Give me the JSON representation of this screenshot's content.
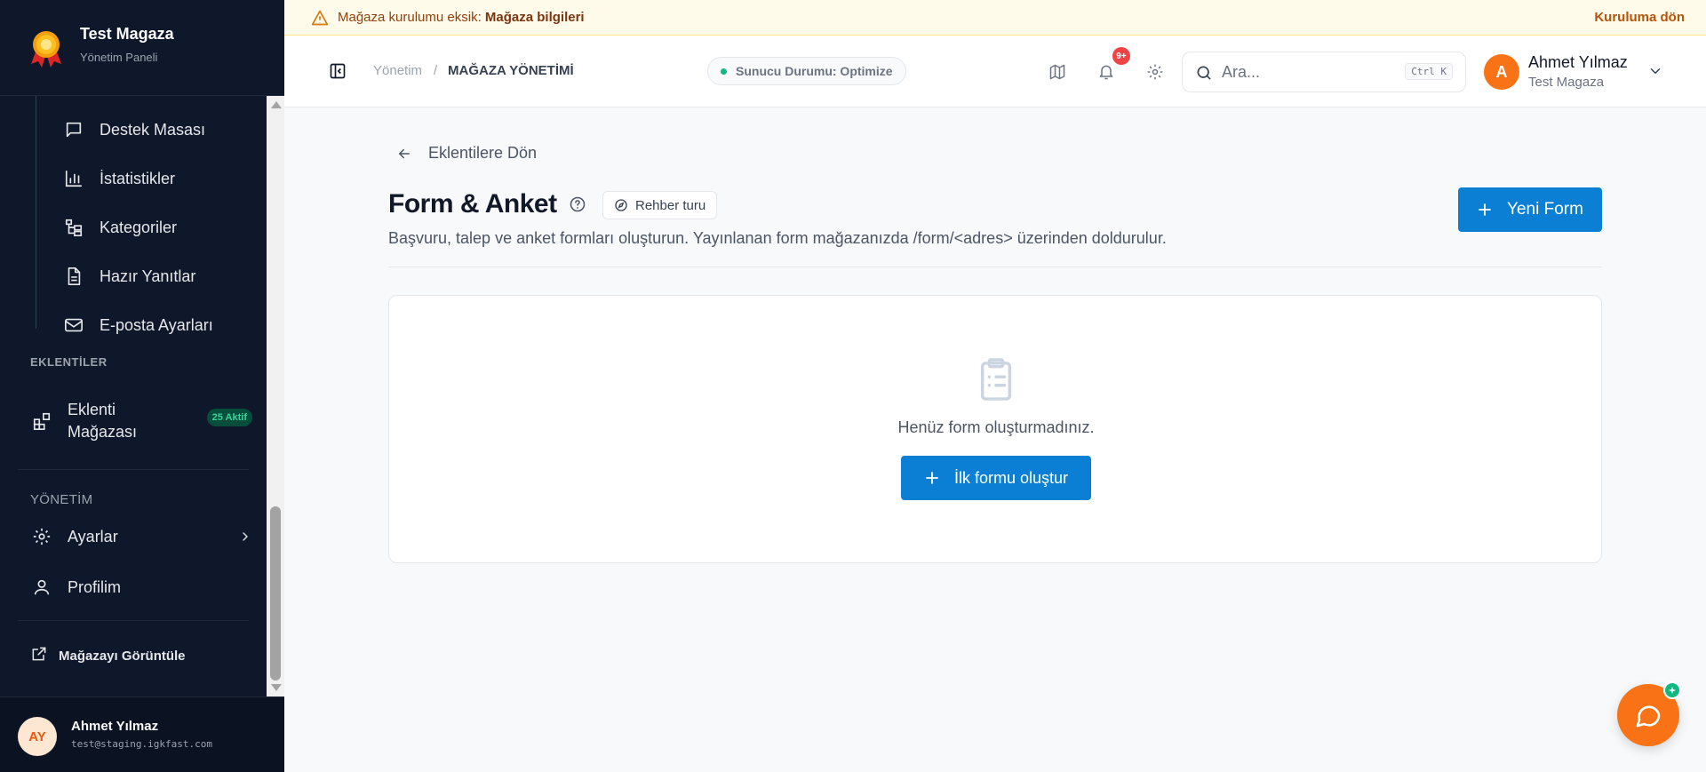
{
  "brand": {
    "name": "Test Magaza",
    "subtitle": "Yönetim Paneli"
  },
  "sidebar": {
    "sub_items": [
      {
        "label": "Destek Masası",
        "icon": "message-square-icon"
      },
      {
        "label": "İstatistikler",
        "icon": "bar-chart-icon"
      },
      {
        "label": "Kategoriler",
        "icon": "folder-tree-icon"
      },
      {
        "label": "Hazır Yanıtlar",
        "icon": "file-text-icon"
      },
      {
        "label": "E-posta Ayarları",
        "icon": "mail-icon"
      }
    ],
    "section_plugins": "EKLENTİLER",
    "plugin_store": {
      "label_line1": "Eklenti",
      "label_line2": "Mağazası",
      "badge": "25 Aktif"
    },
    "section_admin": "YÖNETİM",
    "settings_label": "Ayarlar",
    "profile_label": "Profilim",
    "view_store_label": "Mağazayı Görüntüle",
    "user": {
      "initials": "AY",
      "name": "Ahmet Yılmaz",
      "email": "test@staging.igkfast.com"
    }
  },
  "alert": {
    "prefix": "Mağaza kurulumu eksik: ",
    "emphasis": "Mağaza bilgileri",
    "link": "Kuruluma dön"
  },
  "header": {
    "breadcrumb_home": "Yönetim",
    "breadcrumb_sep": "/",
    "breadcrumb_current": "MAĞAZA YÖNETİMİ",
    "server_status": "Sunucu Durumu: Optimize",
    "notif_count": "9+",
    "search_placeholder": "Ara...",
    "search_shortcut": "Ctrl K",
    "user": {
      "initial": "A",
      "name": "Ahmet Yılmaz",
      "store": "Test Magaza"
    }
  },
  "main": {
    "back_label": "Eklentilere Dön",
    "title": "Form & Anket",
    "guide_label": "Rehber turu",
    "description": "Başvuru, talep ve anket formları oluşturun. Yayınlanan form mağazanızda /form/<adres> üzerinden doldurulur.",
    "new_form_label": "Yeni Form",
    "empty_text": "Henüz form oluşturmadınız.",
    "first_form_label": "İlk formu oluştur"
  },
  "colors": {
    "sidebar_bg": "#0f172a",
    "primary": "#0b7fd4",
    "accent": "#f97316",
    "success": "#10b981",
    "alert_bg": "#fffbeb"
  }
}
